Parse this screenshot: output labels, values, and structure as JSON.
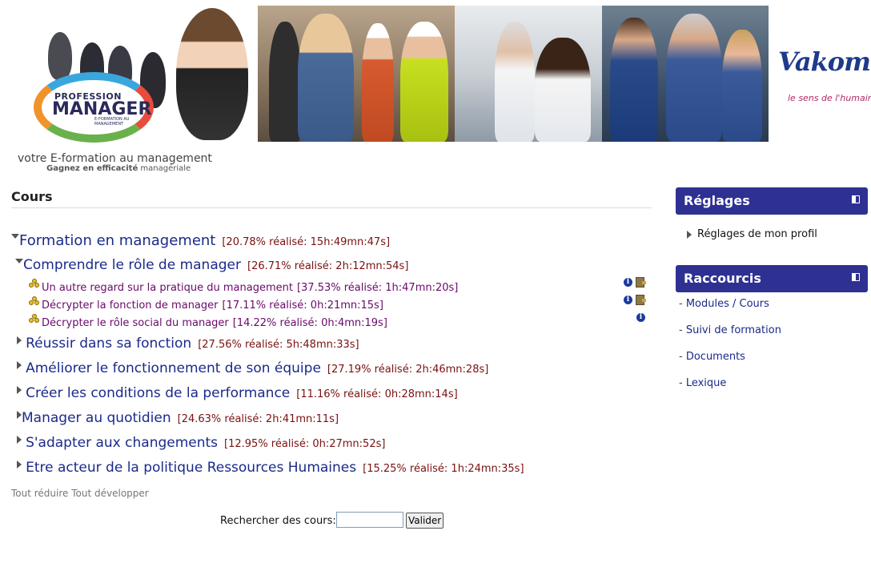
{
  "header": {
    "logo_line1": "PROFESSION",
    "logo_line2": "MANAGER",
    "logo_line3": "E-FORMATION AU MANAGEMENT",
    "tagline": "votre E-formation au management",
    "subtagline_bold": "Gagnez en efficacité",
    "subtagline_rest": "managériale",
    "brand": "Vakom",
    "brand_tagline": "le sens de l'humain"
  },
  "main": {
    "title": "Cours",
    "root": {
      "label": "Formation en management",
      "progress": "[20.78% réalisé: 15h:49mn:47s]"
    },
    "sections": [
      {
        "label": "Comprendre le rôle de manager",
        "progress": "[26.71% réalisé: 2h:12mn:54s]",
        "expanded": true,
        "modules": [
          {
            "label": "Un autre regard sur la pratique du management",
            "progress": "[37.53% réalisé: 1h:47mn:20s]"
          },
          {
            "label": "Décrypter la fonction de manager",
            "progress": "[17.11% réalisé: 0h:21mn:15s]"
          },
          {
            "label": "Décrypter le rôle social du manager",
            "progress": "[14.22% réalisé: 0h:4mn:19s]"
          }
        ]
      },
      {
        "label": "Réussir dans sa fonction",
        "progress": "[27.56% réalisé: 5h:48mn:33s]"
      },
      {
        "label": "Améliorer le fonctionnement de son équipe",
        "progress": "[27.19% réalisé: 2h:46mn:28s]"
      },
      {
        "label": "Créer les conditions de la performance",
        "progress": "[11.16% réalisé: 0h:28mn:14s]"
      },
      {
        "label": "Manager au quotidien",
        "progress": "[24.63% réalisé: 2h:41mn:11s]"
      },
      {
        "label": "S'adapter aux changements",
        "progress": "[12.95% réalisé: 0h:27mn:52s]"
      },
      {
        "label": "Etre acteur de la politique Ressources Humaines",
        "progress": "[15.25% réalisé: 1h:24mn:35s]"
      }
    ],
    "collapse_all": "Tout réduire",
    "expand_all": "Tout développer",
    "search_label": "Rechercher des cours:",
    "search_value": "",
    "search_button": "Valider"
  },
  "sidebar": {
    "settings": {
      "title": "Réglages",
      "items": [
        "Réglages de mon profil"
      ]
    },
    "shortcuts": {
      "title": "Raccourcis",
      "items": [
        "Modules / Cours",
        "Suivi de formation",
        "Documents",
        "Lexique"
      ]
    }
  },
  "colors": {
    "block_header": "#2e3192",
    "link": "#1a2a8a",
    "progress": "#7a1010"
  }
}
